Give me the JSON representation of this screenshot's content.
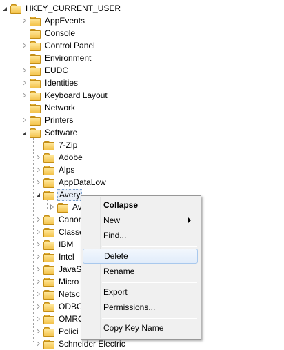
{
  "tree": {
    "root": "HKEY_CURRENT_USER",
    "level1": [
      "AppEvents",
      "Console",
      "Control Panel",
      "Environment",
      "EUDC",
      "Identities",
      "Keyboard Layout",
      "Network",
      "Printers",
      "Software"
    ],
    "software_children": [
      "7-Zip",
      "Adobe",
      "Alps",
      "AppDataLow",
      "Avery"
    ],
    "avery_child": "Av",
    "partial_after": [
      "Canon",
      "Classe",
      "IBM",
      "Intel",
      "JavaSo",
      "Micro",
      "Netsc",
      "ODBC",
      "OMRO",
      "Polici",
      "Schneider Electric"
    ]
  },
  "context_menu": {
    "collapse": "Collapse",
    "new": "New",
    "find": "Find...",
    "delete": "Delete",
    "rename": "Rename",
    "export": "Export",
    "permissions": "Permissions...",
    "copy_key_name": "Copy Key Name"
  },
  "colors": {
    "folder": "#f3c24a",
    "menu_bg": "#f0f0f0",
    "hover_border": "#a8c8ed"
  }
}
